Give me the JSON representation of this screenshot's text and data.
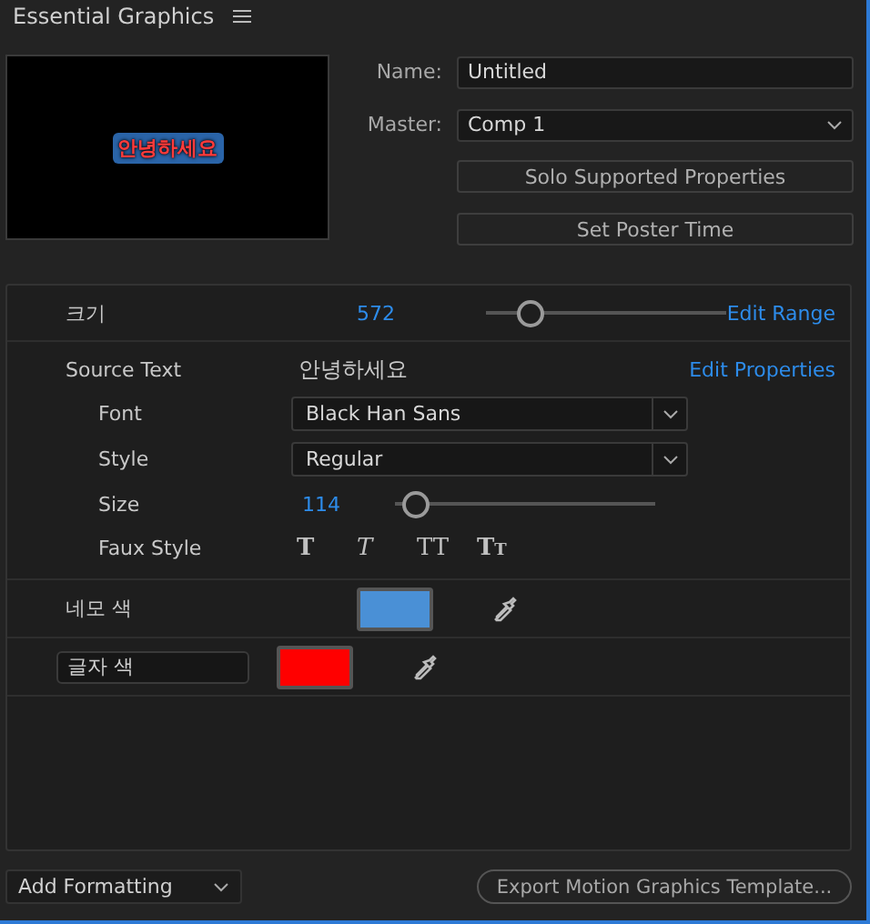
{
  "panel": {
    "title": "Essential Graphics",
    "focused": true
  },
  "preview": {
    "text": "안녕하세요"
  },
  "name": {
    "label": "Name:",
    "value": "Untitled"
  },
  "master": {
    "label": "Master:",
    "value": "Comp 1"
  },
  "buttons": [
    "Solo Supported Properties",
    "Set Poster Time"
  ],
  "size_row": {
    "label": "크기",
    "value": "572",
    "level": 0.18,
    "link": "Edit Range"
  },
  "source_text": {
    "label": "Source Text",
    "value": "안녕하세요",
    "link": "Edit Properties",
    "font": {
      "label": "Font",
      "value": "Black Han Sans"
    },
    "style": {
      "label": "Style",
      "value": "Regular"
    },
    "size": {
      "label": "Size",
      "value": "114",
      "level": 0.08
    },
    "faux": {
      "label": "Faux Style",
      "buttons": [
        {
          "label": "T",
          "kind": "bold"
        },
        {
          "label": "T",
          "kind": "italic"
        },
        {
          "label": "TT",
          "kind": "caps"
        },
        {
          "label": "Tt",
          "kind": "smallcaps"
        }
      ]
    }
  },
  "color_rows": [
    {
      "label": "네모 색",
      "editing": false,
      "color": "#4a90d6"
    },
    {
      "label": "글자 색",
      "editing": true,
      "color": "#ff0000"
    }
  ],
  "add_formatting": "Add Formatting",
  "export": "Export Motion Graphics Template..."
}
